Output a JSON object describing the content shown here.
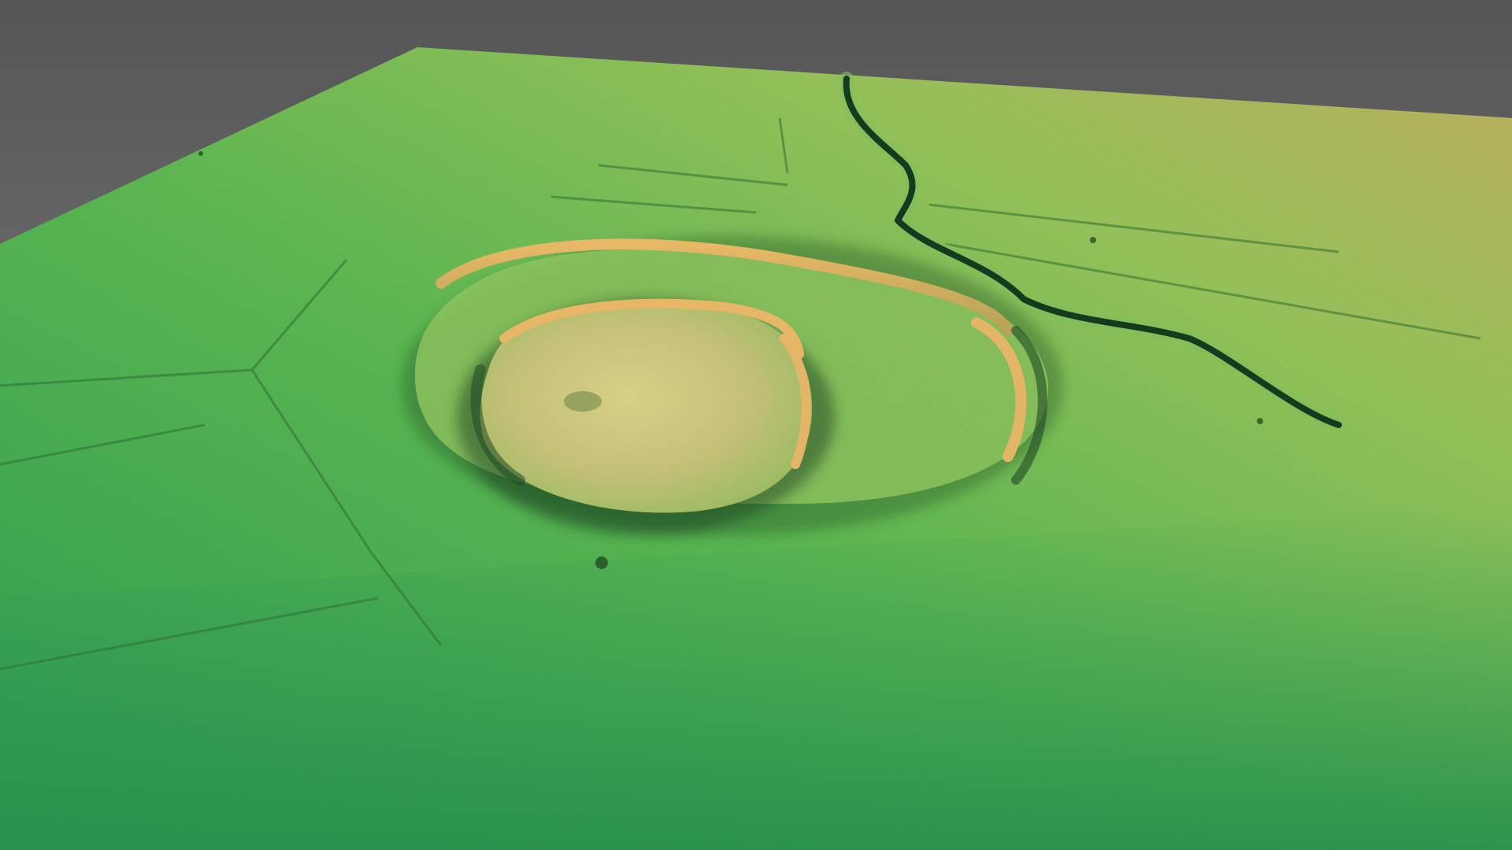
{
  "scene": {
    "subject": "lidar-terrain-relief",
    "colors": {
      "background_top": "#555555",
      "background_bottom": "#8c8c8c",
      "terrain_low": "#2fa85a",
      "terrain_mid": "#7ec85a",
      "terrain_high": "#c9c46a",
      "rampart_crest": "#d9b060",
      "ditch_shadow": "#1f4a26",
      "stream": "#163a1d"
    },
    "features": [
      {
        "name": "inner-enclosure",
        "kind": "hillfort-rampart"
      },
      {
        "name": "outer-enclosure",
        "kind": "hillfort-rampart"
      },
      {
        "name": "stream-channel",
        "kind": "watercourse"
      },
      {
        "name": "field-boundaries",
        "kind": "linear-earthworks"
      }
    ]
  }
}
